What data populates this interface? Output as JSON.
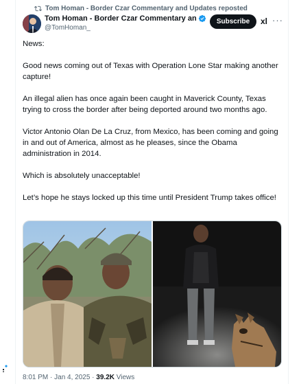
{
  "repost_banner": {
    "text": "Tom Homan - Border Czar Commentary and Updates reposted",
    "icon": "repost-icon"
  },
  "author": {
    "name": "Tom Homan - Border Czar Commentary and Up",
    "handle": "@TomHoman_",
    "verified_icon": "verified-badge-icon",
    "verified_color": "#1d9bf0"
  },
  "actions": {
    "subscribe_label": "Subscribe",
    "grok_label": "xl",
    "more_label": "···"
  },
  "tweet": {
    "paragraphs": [
      "News:",
      "Good news coming out of Texas with Operation Lone Star making another capture!",
      "An illegal alien has once again been caught in Maverick County, Texas trying to cross the border after being deported around two months ago.",
      "Victor Antonio Olan De La Cruz, from Mexico, has been coming and going in and out of America, almost as he pleases, since the Obama administration in 2014.",
      "Which is absolutely unacceptable!",
      "Let’s hope he stays locked up this time until President Trump takes office!"
    ]
  },
  "media": [
    {
      "name": "photo-two-men-brush",
      "description_icon": "photo-icon"
    },
    {
      "name": "photo-man-at-night-with-dog",
      "description_icon": "photo-icon"
    }
  ],
  "meta": {
    "time": "8:01 PM",
    "separator": " · ",
    "date": "Jan 4, 2025",
    "views_count": "39.2K",
    "views_label": " Views"
  },
  "colors": {
    "accent": "#1d9bf0",
    "text": "#0f1419",
    "muted": "#536471",
    "border": "#cfd9de"
  }
}
